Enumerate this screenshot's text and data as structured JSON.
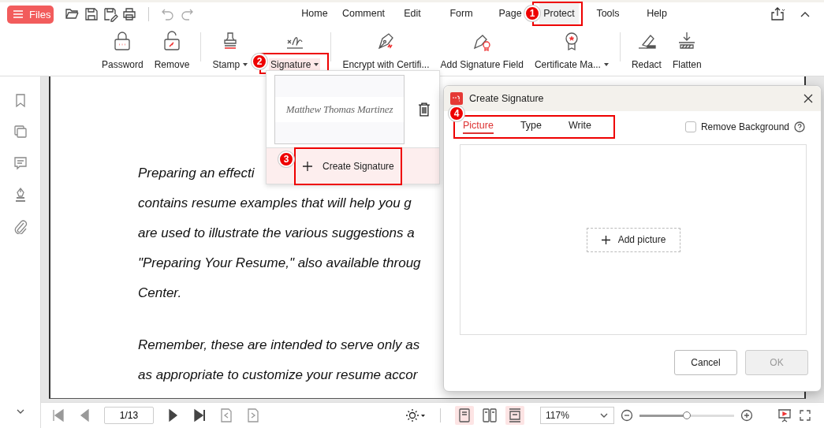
{
  "toolbar": {
    "files_button": "Files",
    "quick_actions": [
      {
        "kind": "open",
        "disabled": false
      },
      {
        "kind": "save",
        "disabled": false
      },
      {
        "kind": "save-as",
        "disabled": false
      },
      {
        "kind": "print",
        "disabled": false
      },
      {
        "kind": "undo",
        "disabled": true
      },
      {
        "kind": "redo",
        "disabled": true
      }
    ]
  },
  "menu_tabs": [
    {
      "label": "Home",
      "selected": false
    },
    {
      "label": "Comment",
      "selected": false
    },
    {
      "label": "Edit",
      "selected": false
    },
    {
      "label": "Form",
      "selected": false
    },
    {
      "label": "Page",
      "selected": false
    },
    {
      "label": "Protect",
      "selected": true,
      "callout": "1"
    },
    {
      "label": "Tools",
      "selected": false
    },
    {
      "label": "Help",
      "selected": false
    }
  ],
  "ribbon": {
    "groups": [
      [
        {
          "kind": "password",
          "label": "Password",
          "dropdown": false,
          "pressed": false
        },
        {
          "kind": "remove",
          "label": "Remove",
          "dropdown": false,
          "pressed": false
        }
      ],
      [
        {
          "kind": "stamp",
          "label": "Stamp",
          "dropdown": true,
          "pressed": false
        },
        {
          "kind": "signature",
          "label": "Signature",
          "dropdown": true,
          "pressed": true,
          "callout": "2"
        }
      ],
      [
        {
          "kind": "encrypt",
          "label": "Encrypt with Certifi...",
          "dropdown": false,
          "pressed": false
        },
        {
          "kind": "add-field",
          "label": "Add Signature Field",
          "dropdown": false,
          "pressed": false
        },
        {
          "kind": "certificate",
          "label": "Certificate Ma...",
          "dropdown": true,
          "pressed": false
        }
      ],
      [
        {
          "kind": "redact",
          "label": "Redact",
          "dropdown": false,
          "pressed": false
        },
        {
          "kind": "flatten",
          "label": "Flatten",
          "dropdown": false,
          "pressed": false
        }
      ]
    ]
  },
  "sidebar": {
    "items": [
      {
        "kind": "bookmark"
      },
      {
        "kind": "pages"
      },
      {
        "kind": "comment"
      },
      {
        "kind": "signature"
      },
      {
        "kind": "attachment"
      }
    ]
  },
  "document": {
    "paragraphs": [
      [
        "Preparing an effecti",
        "contains resume examples that will help you g",
        "are used to illustrate the various suggestions a",
        "\"Preparing Your Resume,\" also available throug",
        "Center."
      ],
      [
        "Remember, these are intended to serve only as",
        "as appropriate to customize your resume accor"
      ]
    ]
  },
  "signature_menu": {
    "signatures": [
      {
        "text": "Matthew Thomas Martinez"
      }
    ],
    "create": {
      "label": "Create Signature",
      "callout": "3"
    }
  },
  "dialog": {
    "title": "Create Signature",
    "tabs_callout": "4",
    "tabs": [
      {
        "label": "Picture",
        "selected": true
      },
      {
        "label": "Type",
        "selected": false
      },
      {
        "label": "Write",
        "selected": false
      }
    ],
    "remove_background": {
      "label": "Remove Background",
      "checked": false
    },
    "add_picture": "Add picture",
    "buttons": [
      {
        "label": "Cancel",
        "disabled": false
      },
      {
        "label": "OK",
        "disabled": true
      }
    ]
  },
  "status_bar": {
    "nav": [
      {
        "kind": "first",
        "disabled": true
      },
      {
        "kind": "prev",
        "disabled": true
      },
      {
        "kind": "page-field",
        "text": "1/13"
      },
      {
        "kind": "next",
        "disabled": false
      },
      {
        "kind": "last",
        "disabled": false
      },
      {
        "kind": "back-view",
        "disabled": true
      },
      {
        "kind": "forward-view",
        "disabled": true
      }
    ],
    "views": [
      {
        "kind": "single",
        "selected": true
      },
      {
        "kind": "double",
        "selected": false
      },
      {
        "kind": "scroll",
        "selected": true
      }
    ],
    "zoom": "117%",
    "zoom_slider": {
      "level": 0.5
    }
  }
}
